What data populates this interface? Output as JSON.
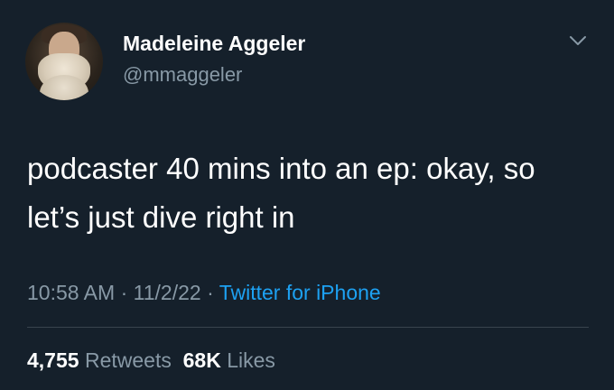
{
  "author": {
    "name": "Madeleine Aggeler",
    "handle": "@mmaggeler"
  },
  "tweet": {
    "text": "podcaster 40 mins into an ep: okay, so let’s just dive right in",
    "time": "10:58 AM",
    "date": "11/2/22",
    "separator": "·",
    "source": "Twitter for iPhone"
  },
  "stats": {
    "retweets_count": "4,755",
    "retweets_label": "Retweets",
    "likes_count": "68K",
    "likes_label": "Likes"
  },
  "icons": {
    "menu": "chevron-down-icon"
  },
  "colors": {
    "background": "#15202b",
    "text": "#ffffff",
    "muted": "#8899a6",
    "link": "#1da1f2",
    "divider": "#38444d"
  }
}
